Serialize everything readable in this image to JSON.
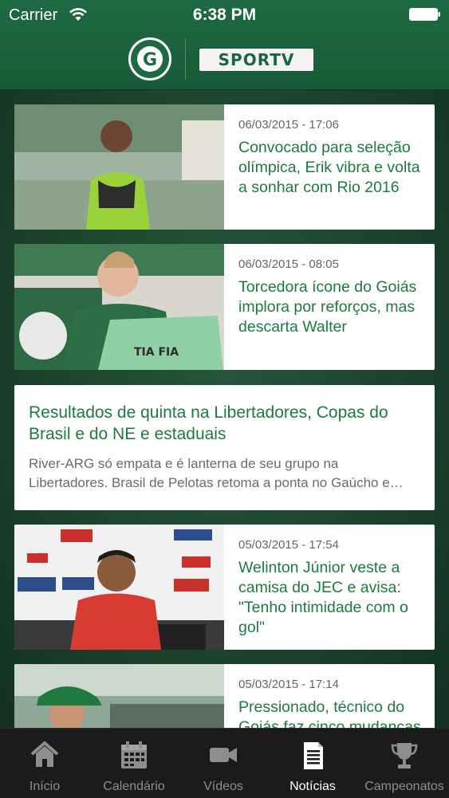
{
  "status_bar": {
    "carrier": "Carrier",
    "time": "6:38 PM"
  },
  "header": {
    "club_logo_text": "GOIÁS ESPORTE CLUBE",
    "partner_logo": "SPORTV"
  },
  "feed": {
    "items": [
      {
        "type": "image",
        "date": "06/03/2015 - 17:06",
        "title": "Convocado para seleção olímpica, Erik vibra e volta a sonhar com Rio 2016"
      },
      {
        "type": "image",
        "date": "06/03/2015 - 08:05",
        "title": "Torcedora ícone do Goiás implora por reforços, mas descarta Walter"
      },
      {
        "type": "text",
        "title": "Resultados de quinta na Libertadores, Copas do Brasil e do NE e estaduais",
        "summary": "River-ARG só empata e é lanterna de seu grupo na Libertadores. Brasil de Pelotas retoma a ponta no Gaúcho e mais"
      },
      {
        "type": "image",
        "date": "05/03/2015 - 17:54",
        "title": "Welinton Júnior veste a camisa do JEC e avisa: \"Tenho intimidade com o gol\""
      },
      {
        "type": "image",
        "date": "05/03/2015 - 17:14",
        "title": "Pressionado, técnico do Goiás faz cinco mudanças"
      }
    ]
  },
  "tabbar": {
    "tabs": [
      {
        "label": "Início",
        "icon": "home-icon",
        "active": false
      },
      {
        "label": "Calendário",
        "icon": "calendar-icon",
        "active": false
      },
      {
        "label": "Vídeos",
        "icon": "video-camera-icon",
        "active": false
      },
      {
        "label": "Notícias",
        "icon": "news-document-icon",
        "active": true
      },
      {
        "label": "Campeonatos",
        "icon": "trophy-icon",
        "active": false
      }
    ]
  },
  "colors": {
    "brand_green": "#1e6a43",
    "headline_green": "#1e7a3f",
    "tabbar_bg": "#1b1b1b"
  }
}
